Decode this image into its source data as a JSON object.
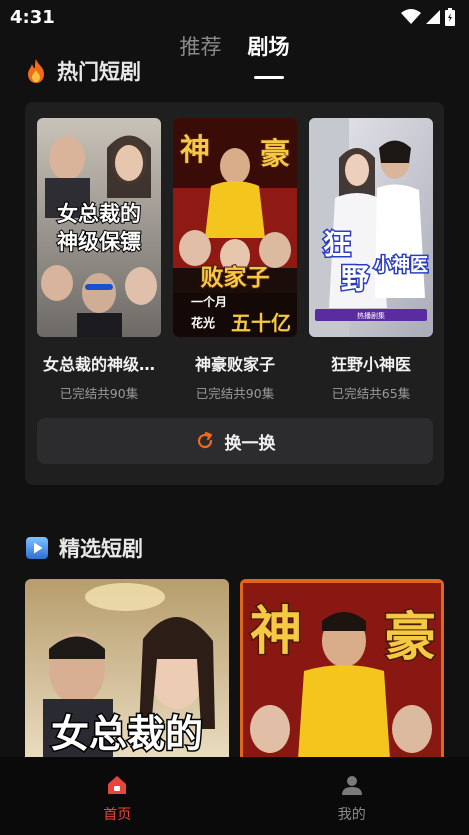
{
  "status": {
    "time": "4:31"
  },
  "tabs": [
    {
      "label": "推荐",
      "active": false
    },
    {
      "label": "剧场",
      "active": true
    }
  ],
  "hot": {
    "title": "热门短剧",
    "icon": "flame-icon",
    "items": [
      {
        "name": "女总裁的神级…",
        "meta": "已完结共90集",
        "poster_text": [
          "女总裁的",
          "神级保镖"
        ]
      },
      {
        "name": "神豪败家子",
        "meta": "已完结共90集",
        "poster_text": [
          "神",
          "豪",
          "败家子",
          "一个月",
          "花光",
          "五十亿"
        ]
      },
      {
        "name": "狂野小神医",
        "meta": "已完结共65集",
        "poster_text": [
          "狂",
          "野",
          "小神医",
          "热播剧集"
        ]
      }
    ],
    "refresh_label": "换一换"
  },
  "featured": {
    "title": "精选短剧",
    "icon": "play-icon",
    "items": [
      {
        "poster_text": [
          "女总裁的"
        ]
      },
      {
        "poster_text": [
          "神",
          "豪"
        ]
      }
    ]
  },
  "nav": {
    "home_label": "首页",
    "mine_label": "我的"
  },
  "colors": {
    "accent": "#e8453c",
    "background": "#111112",
    "card": "#1f1f20"
  }
}
